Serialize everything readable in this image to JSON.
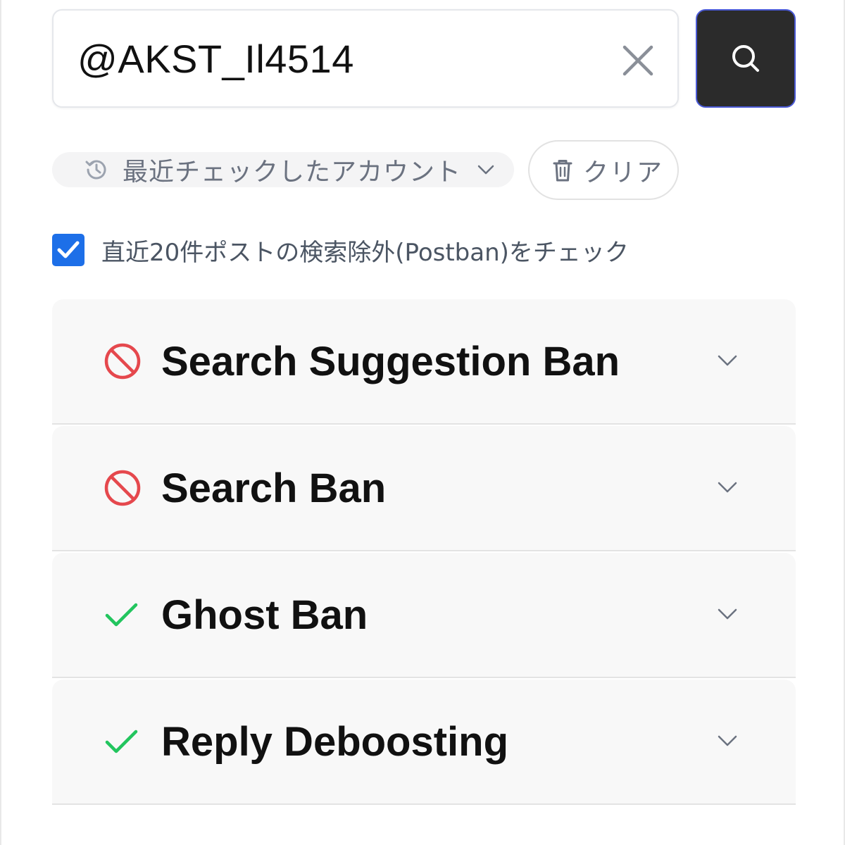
{
  "search": {
    "value": "@AKST_Il4514",
    "clear_icon": "close-icon",
    "button_icon": "search-icon"
  },
  "recent": {
    "icon": "history-icon",
    "label": "最近チェックしたアカウント",
    "chevron": "chevron-down-icon"
  },
  "clear_button": {
    "icon": "trash-icon",
    "label": "クリア"
  },
  "postban_option": {
    "checked": true,
    "label": "直近20件ポストの検索除外(Postban)をチェック"
  },
  "results": [
    {
      "label": "Search Suggestion Ban",
      "status": "banned",
      "icon": "ban-icon"
    },
    {
      "label": "Search Ban",
      "status": "banned",
      "icon": "ban-icon"
    },
    {
      "label": "Ghost Ban",
      "status": "ok",
      "icon": "check-icon"
    },
    {
      "label": "Reply Deboosting",
      "status": "ok",
      "icon": "check-icon"
    }
  ],
  "colors": {
    "search_button_bg": "#2b2b2b",
    "search_button_border": "#4b5ad6",
    "checkbox_bg": "#1d6fe8",
    "banned": "#e5484d",
    "ok": "#22c55e",
    "panel_bg": "#f8f8f8"
  }
}
